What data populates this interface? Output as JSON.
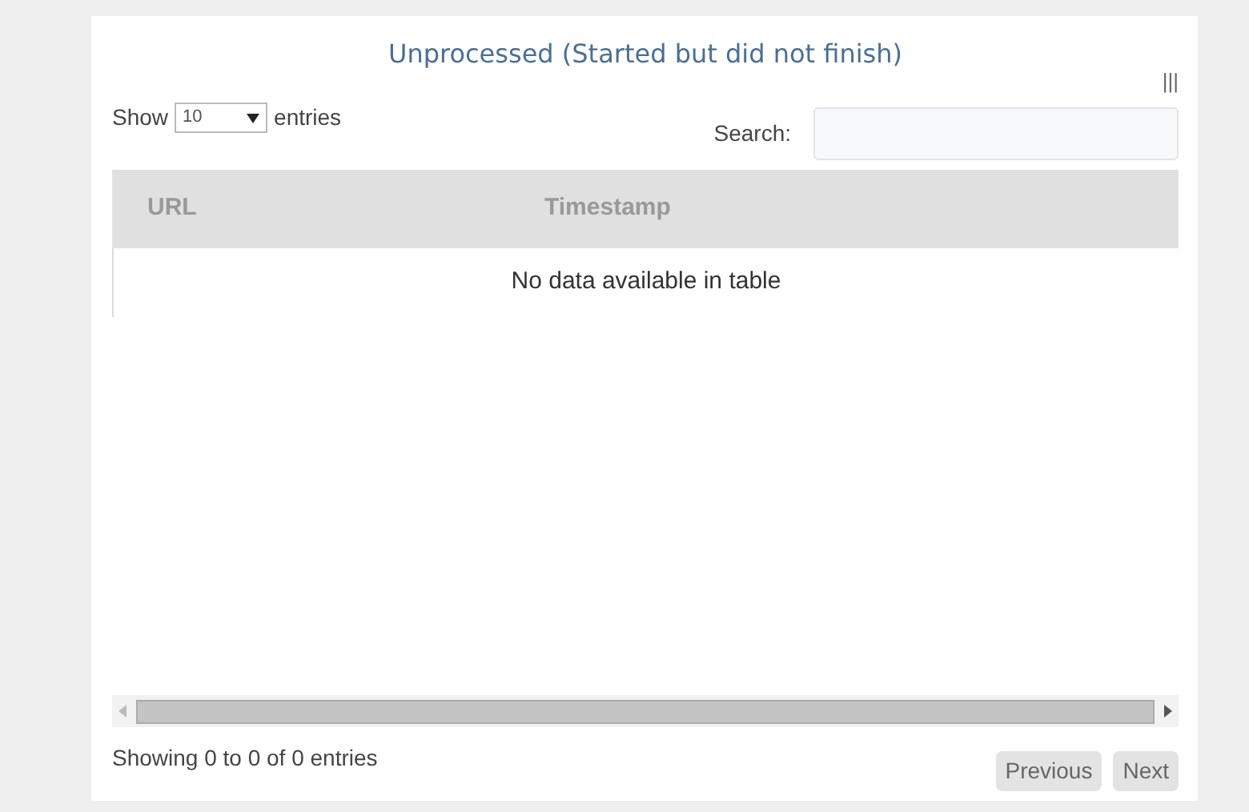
{
  "panel": {
    "title": "Unprocessed (Started but did not finish)",
    "columns_toggle": "|||"
  },
  "length": {
    "label_before": "Show",
    "value": "10",
    "label_after": "entries"
  },
  "search": {
    "label": "Search:"
  },
  "table": {
    "columns": [
      "URL",
      "Timestamp"
    ],
    "empty_message": "No data available in table"
  },
  "info": "Showing 0 to 0 of 0 entries",
  "pagination": [
    {
      "label": "Previous",
      "disabled": true
    },
    {
      "label": "Next",
      "disabled": true
    }
  ]
}
